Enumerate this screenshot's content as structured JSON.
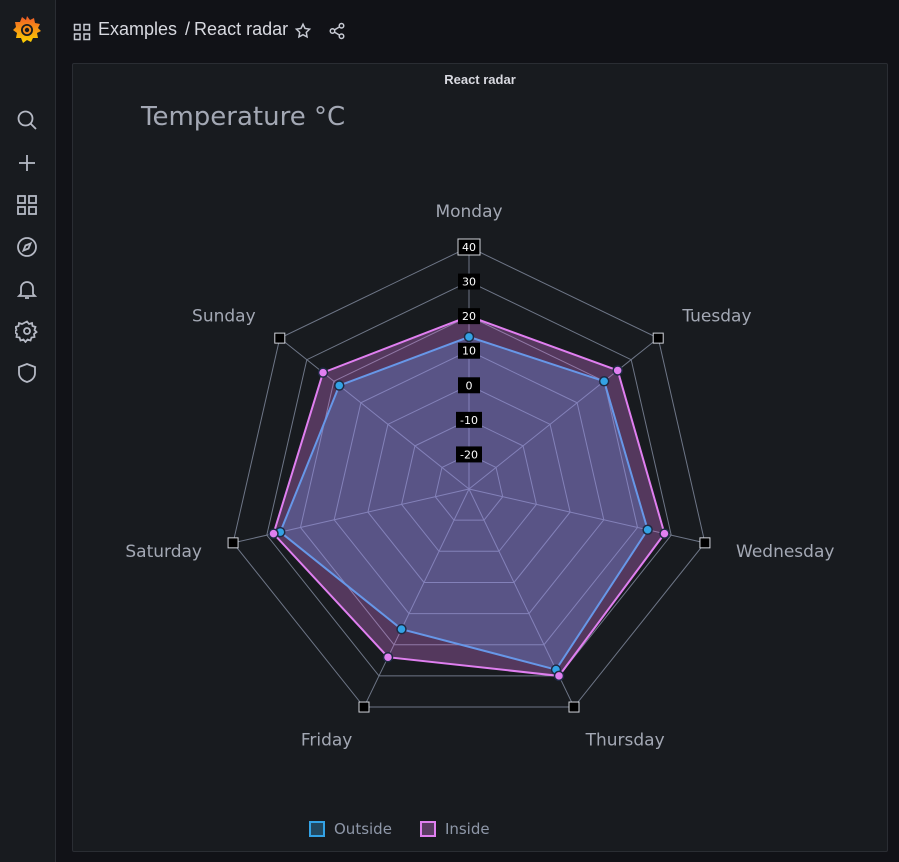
{
  "app": {
    "name": "Grafana"
  },
  "header": {
    "breadcrumb_folder": "Examples",
    "breadcrumb_separator": "/",
    "breadcrumb_page": "React radar"
  },
  "sidebar": {
    "items": [
      {
        "icon": "search-icon"
      },
      {
        "icon": "plus-icon"
      },
      {
        "icon": "dashboards-icon"
      },
      {
        "icon": "explore-compass-icon"
      },
      {
        "icon": "alerting-bell-icon"
      },
      {
        "icon": "settings-gear-icon"
      },
      {
        "icon": "shield-icon"
      }
    ]
  },
  "panel": {
    "title": "React radar"
  },
  "chart_data": {
    "type": "radar",
    "title": "Temperature °C",
    "axes": [
      "Monday",
      "Tuesday",
      "Wednesday",
      "Thursday",
      "Friday",
      "Saturday",
      "Sunday"
    ],
    "range": [
      -30,
      40
    ],
    "ticks": [
      40,
      30,
      20,
      10,
      0,
      -10,
      -20
    ],
    "series": [
      {
        "name": "Outside",
        "values": [
          14,
          20,
          23,
          28,
          15,
          26,
          18
        ],
        "color": "#33a2e5"
      },
      {
        "name": "Inside",
        "values": [
          20,
          25,
          28,
          30,
          24,
          28,
          24
        ],
        "color": "#e07ff0"
      }
    ],
    "legend": "bottom-center",
    "grid": true
  },
  "colors": {
    "background": "#111217",
    "panel": "#181b1f",
    "grid": "#6e7687",
    "accent_orange": "#f46800"
  }
}
